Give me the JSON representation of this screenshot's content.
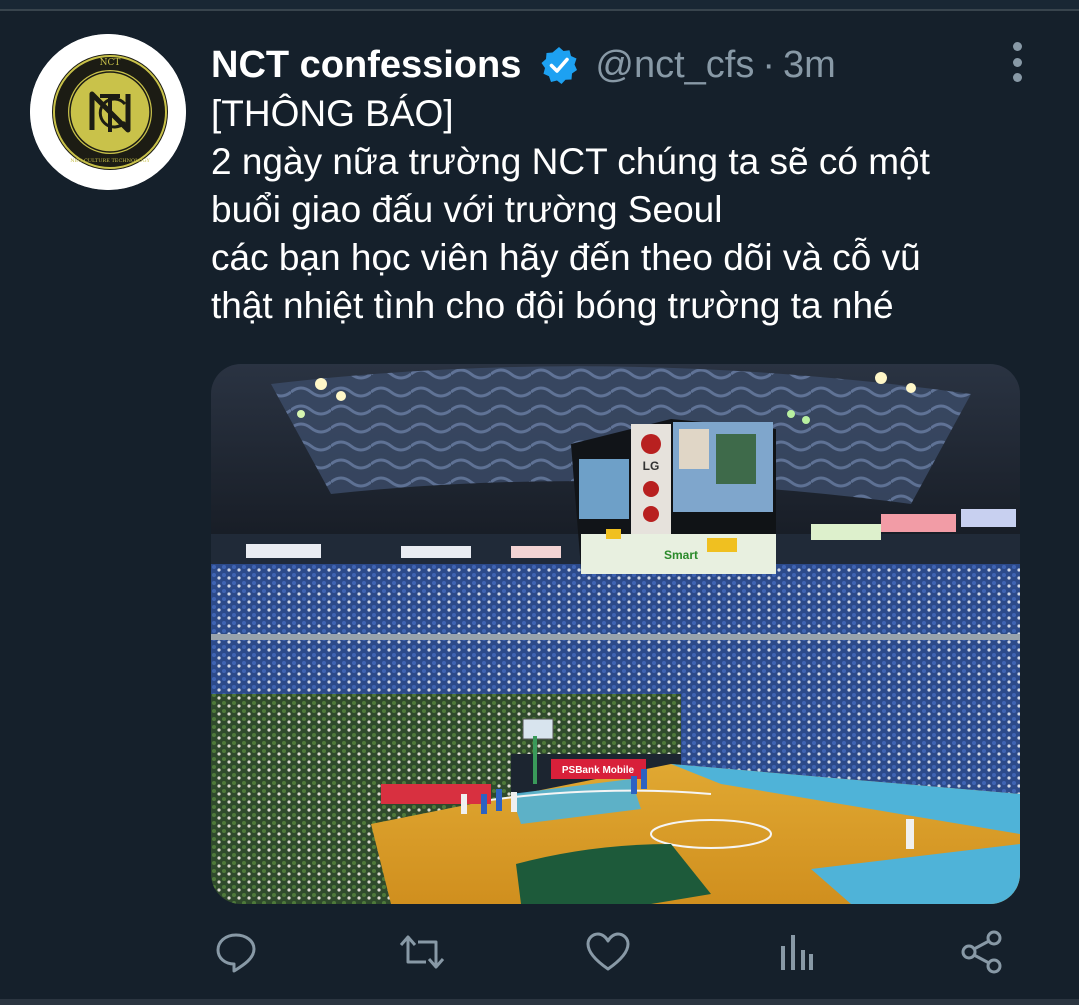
{
  "tweet": {
    "display_name": "NCT confessions",
    "handle": "@nct_cfs",
    "separator": "·",
    "time": "3m",
    "verified": true,
    "text_lines": [
      "[THÔNG BÁO]",
      "2 ngày nữa trường NCT chúng ta sẽ có một",
      "buổi giao đấu với trường Seoul",
      "các bạn học viên hãy đến theo dõi và cỗ vũ",
      "thật nhiệt tình cho đội bóng trường ta nhé"
    ]
  },
  "avatar": {
    "logo_letters": "NCT",
    "logo_ring_text": "NEO CULTURE TECHNOLOGY"
  },
  "media": {
    "description_icon": "basketball-arena-photo",
    "scoreboard_brand": "LG",
    "sponsor_text": "Smart",
    "court_banner": "PSBank Mobile"
  },
  "actions": [
    {
      "name": "reply",
      "icon": "speech-bubble-icon"
    },
    {
      "name": "retweet",
      "icon": "retweet-icon"
    },
    {
      "name": "like",
      "icon": "heart-icon"
    },
    {
      "name": "analytics",
      "icon": "bar-chart-icon"
    },
    {
      "name": "share",
      "icon": "share-icon"
    }
  ],
  "colors": {
    "background": "#15202b",
    "text_primary": "#ffffff",
    "text_secondary": "#8899a6",
    "verified_blue": "#1da1f2",
    "logo_gold": "#c9c24a",
    "logo_dark": "#1c1c14"
  }
}
